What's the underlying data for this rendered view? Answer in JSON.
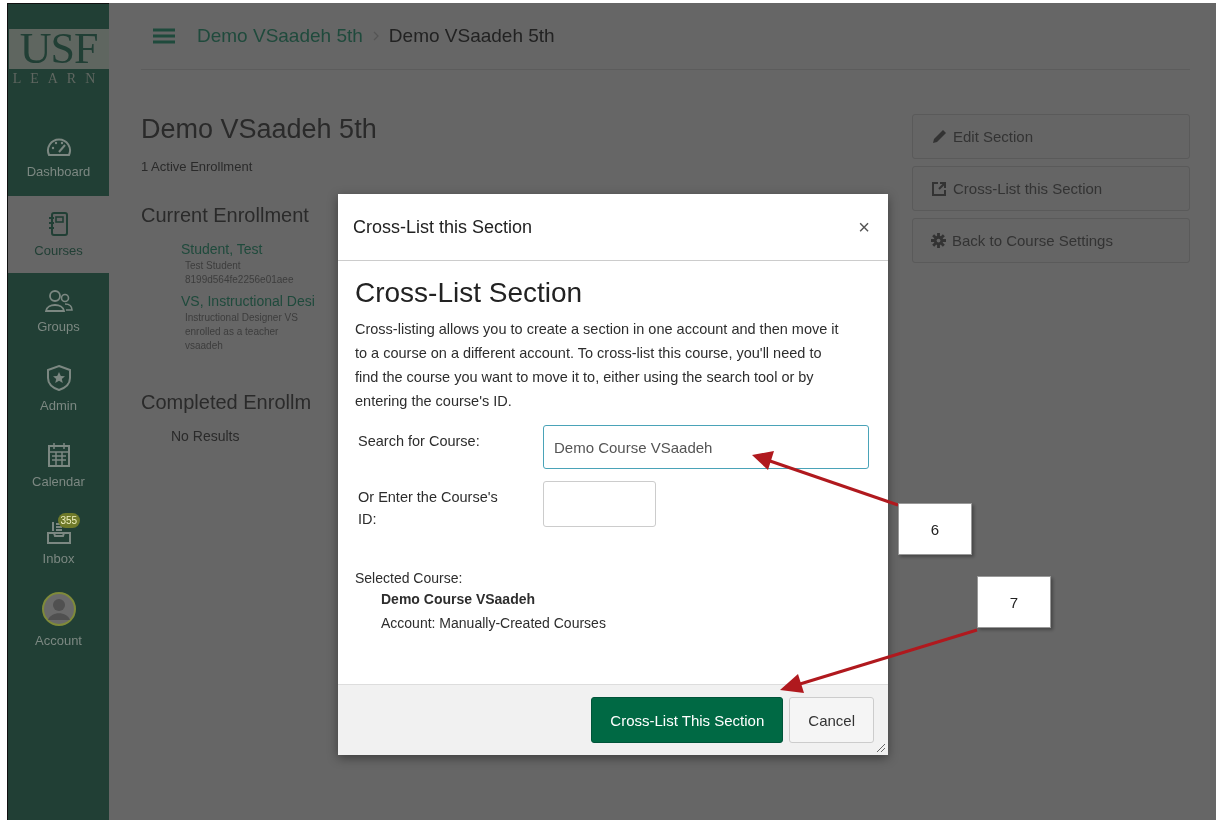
{
  "sidebar": {
    "logo": {
      "top": "USF",
      "bottom": "LEARN"
    },
    "items": [
      {
        "label": "Dashboard",
        "kind": "dashboard",
        "selected": false
      },
      {
        "label": "Courses",
        "kind": "courses",
        "selected": true
      },
      {
        "label": "Groups",
        "kind": "groups",
        "selected": false
      },
      {
        "label": "Admin",
        "kind": "admin",
        "selected": false
      },
      {
        "label": "Calendar",
        "kind": "calendar",
        "selected": false
      },
      {
        "label": "Inbox",
        "kind": "inbox",
        "selected": false,
        "badge": "355"
      },
      {
        "label": "Account",
        "kind": "account",
        "selected": false
      }
    ]
  },
  "breadcrumb": [
    "Demo VSaadeh 5th",
    "Demo VSaadeh 5th"
  ],
  "page": {
    "title": "Demo VSaadeh 5th",
    "subtitle": "1 Active Enrollment",
    "current_heading": "Current Enrollment",
    "enrollments": [
      {
        "name": "Student, Test",
        "lines": [
          "Test Student",
          "8199d564fe2256e01aee"
        ]
      },
      {
        "name": "VS, Instructional Desi",
        "lines": [
          "Instructional Designer VS",
          "enrolled as a teacher",
          "vsaadeh"
        ]
      }
    ],
    "completed_heading": "Completed Enrollm",
    "no_results": "No Results"
  },
  "actions": [
    {
      "label": "Edit Section",
      "kind": "edit"
    },
    {
      "label": "Cross-List this Section",
      "kind": "crosslist"
    },
    {
      "label": "Back to Course Settings",
      "kind": "settings"
    }
  ],
  "modal": {
    "title": "Cross-List this Section",
    "close": "×",
    "heading": "Cross-List Section",
    "description": "Cross-listing allows you to create a section in one account and then move it to a course on a different account. To cross-list this course, you'll need to find the course you want to move it to, either using the search tool or by entering the course's ID.",
    "search_label": "Search for Course:",
    "search_value": "Demo Course VSaadeh",
    "id_label": "Or Enter the Course's ID:",
    "selected_label": "Selected Course:",
    "selected_course": "Demo Course VSaadeh",
    "selected_account": "Account: Manually-Created Courses",
    "buttons": [
      {
        "label": "Cross-List This Section",
        "kind": "primary"
      },
      {
        "label": "Cancel",
        "kind": "default"
      }
    ]
  },
  "callouts": [
    "6",
    "7"
  ]
}
